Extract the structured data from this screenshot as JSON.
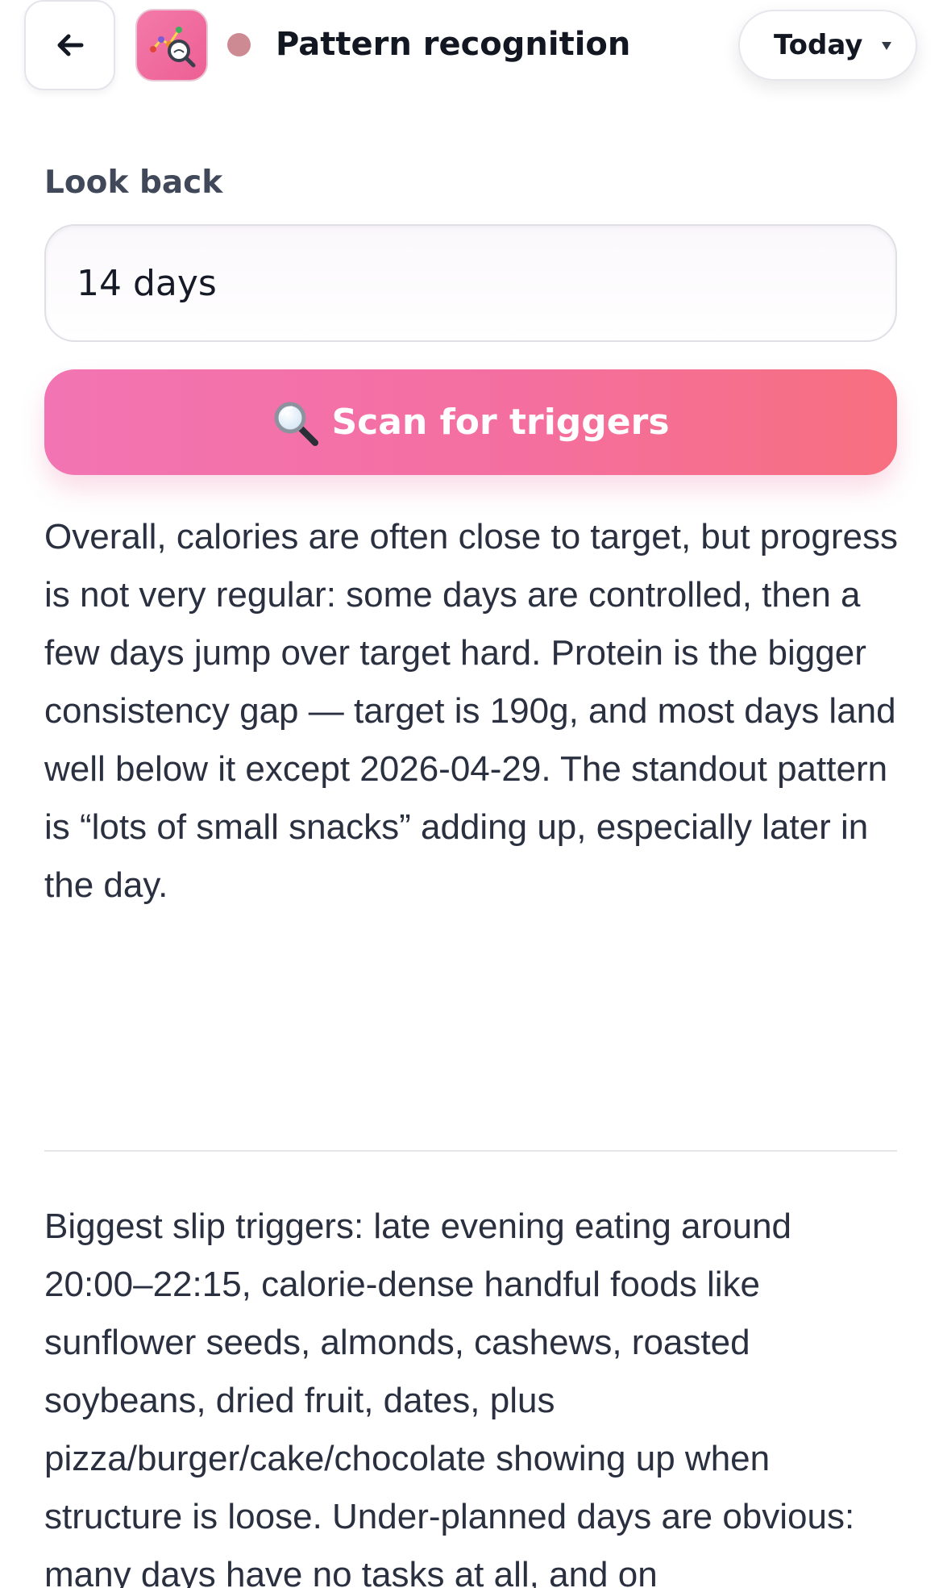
{
  "header": {
    "back_icon": "arrow-left-icon",
    "app_icon": "pattern-chart-magnifier-icon",
    "status_color": "#cd8a93",
    "title": "Pattern recognition",
    "date_selector": {
      "value": "Today",
      "icon": "chevron-down-icon"
    }
  },
  "lookback": {
    "label": "Look back",
    "value": "14 days"
  },
  "scan_button": {
    "icon": "magnifier-icon",
    "label": "Scan for triggers",
    "gradient": [
      "#f274b2",
      "#f76f7f"
    ]
  },
  "insights": {
    "summary": "Overall, calories are often close to target, but progress is not very regular: some days are controlled, then a few days jump over target hard. Protein is the bigger consistency gap — target is 190g, and most days land well below it except 2026-04-29. The standout pattern is “lots of small snacks” adding up, especially later in the day.",
    "triggers": "Biggest slip triggers: late evening eating around 20:00–22:15, calorie-dense handful foods like sunflower seeds, almonds, cashews, roasted soybeans, dried fruit, dates, plus pizza/burger/cake/chocolate showing up when structure is loose. Under-planned days are obvious: many days have no tasks at all, and on"
  }
}
